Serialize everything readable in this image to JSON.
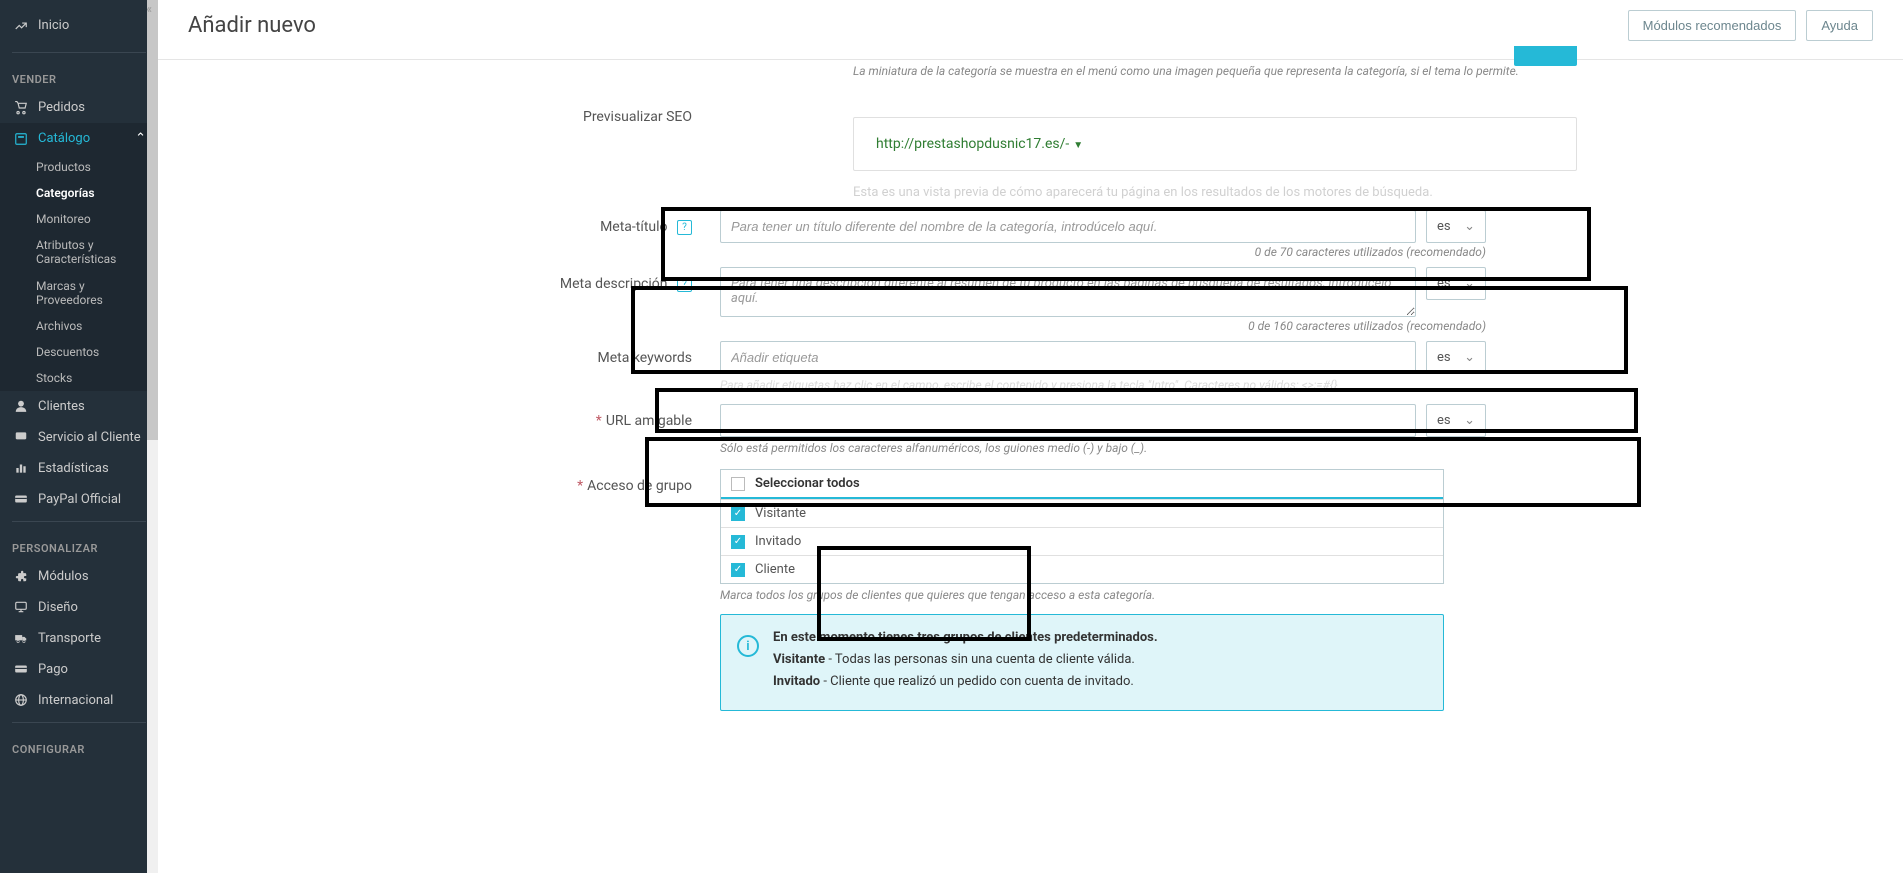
{
  "sidebar": {
    "collapse_icon": "«",
    "top": {
      "inicio": "Inicio"
    },
    "sections": {
      "vender": "VENDER",
      "personalizar": "PERSONALIZAR",
      "configurar": "CONFIGURAR"
    },
    "items": {
      "pedidos": "Pedidos",
      "catalogo": "Catálogo",
      "clientes": "Clientes",
      "servicio": "Servicio al Cliente",
      "estadisticas": "Estadísticas",
      "paypal": "PayPal Official",
      "modulos": "Módulos",
      "diseno": "Diseño",
      "transporte": "Transporte",
      "pago": "Pago",
      "internacional": "Internacional"
    },
    "catalogo_sub": {
      "productos": "Productos",
      "categorias": "Categorías",
      "monitoreo": "Monitoreo",
      "atributos": "Atributos y Características",
      "marcas": "Marcas y Proveedores",
      "archivos": "Archivos",
      "descuentos": "Descuentos",
      "stocks": "Stocks"
    }
  },
  "header": {
    "title": "Añadir nuevo",
    "modulos_btn": "Módulos recomendados",
    "ayuda_btn": "Ayuda"
  },
  "form": {
    "thumb_help": "La miniatura de la categoría se muestra en el menú como una imagen pequeña que representa la categoría, si el tema lo permite.",
    "seo_preview_label": "Previsualizar SEO",
    "seo_url": "http://prestashopdusnic17.es/-",
    "seo_overlay": "Esta es una vista previa de cómo aparecerá tu página en los resultados de los motores de búsqueda.",
    "meta_title_label": "Meta-título",
    "meta_title_placeholder": "Para tener un título diferente del nombre de la categoría, introdúcelo aquí.",
    "meta_title_counter": "0 de 70 caracteres utilizados (recomendado)",
    "meta_desc_label": "Meta descripción",
    "meta_desc_placeholder": "Para tener una descripción diferente al resumen de tu producto en las páginas de búsqueda de resultados, introdúcelo aquí.",
    "meta_desc_counter": "0 de 160 caracteres utilizados (recomendado)",
    "meta_keywords_label": "Meta keywords",
    "meta_keywords_placeholder": "Añadir etiqueta",
    "meta_keywords_help": "Para añadir etiquetas haz clic en el campo, escribe el contenido y presiona la tecla \"Intro\". Caracteres no válidos: <>;=#{}",
    "url_label": "URL amigable",
    "url_help": "Sólo está permitidos los caracteres alfanuméricos, los guiones medio (-) y bajo (_).",
    "grupo_label": "Acceso de grupo",
    "grupo_select_all": "Seleccionar todos",
    "grupo_visitante": "Visitante",
    "grupo_invitado": "Invitado",
    "grupo_cliente": "Cliente",
    "grupo_help": "Marca todos los grupos de clientes que quieres que tengan acceso a esta categoría.",
    "lang": "es",
    "alert_title": "En este momento tienes tres grupos de clientes predeterminados.",
    "alert_visitante_b": "Visitante",
    "alert_visitante_t": " - Todas las personas sin una cuenta de cliente válida.",
    "alert_invitado_b": "Invitado",
    "alert_invitado_t": " - Cliente que realizó un pedido con cuenta de invitado."
  }
}
